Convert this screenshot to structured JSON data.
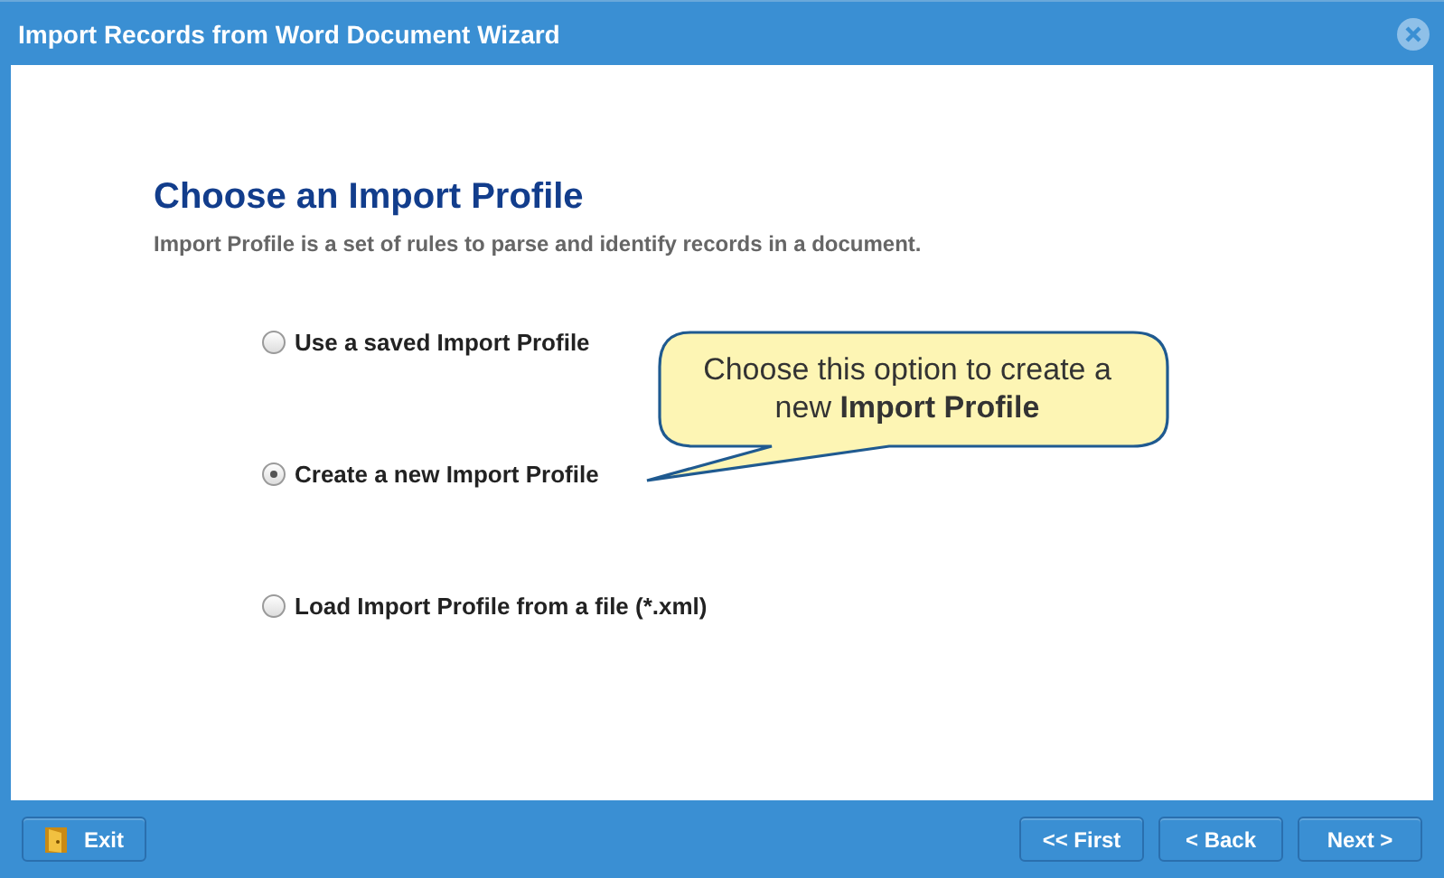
{
  "window": {
    "title": "Import Records from Word Document Wizard"
  },
  "heading": "Choose an Import Profile",
  "description": "Import Profile is a set of rules to parse and identify records in a document.",
  "options": [
    {
      "label": "Use a saved Import Profile",
      "selected": false
    },
    {
      "label": "Create a new Import Profile",
      "selected": true
    },
    {
      "label": "Load Import Profile from a file (*.xml)",
      "selected": false
    }
  ],
  "callout": {
    "text": "Choose this option to create a new **Import Profile**"
  },
  "footer": {
    "exit": "Exit",
    "buttons": [
      "<< First",
      "< Back",
      "Next >"
    ]
  }
}
